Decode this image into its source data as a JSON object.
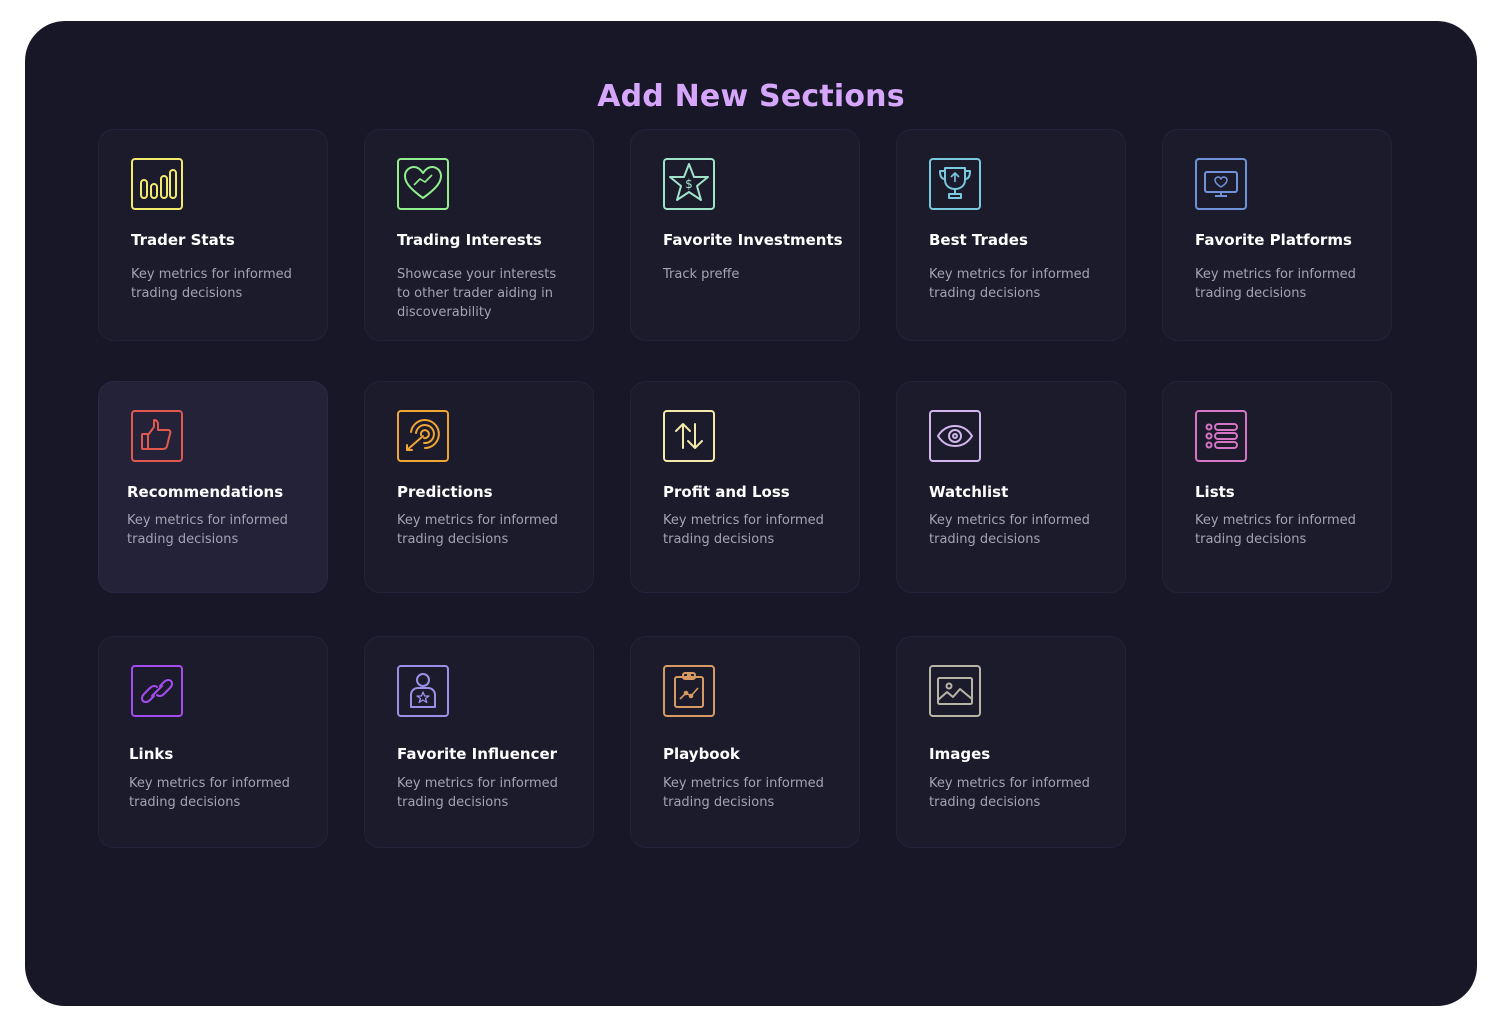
{
  "page": {
    "title": "Add New Sections"
  },
  "sections": [
    {
      "id": "trader-stats",
      "title": "Trader Stats",
      "description": "Key metrics for informed trading decisions",
      "icon": "bar-chart-icon",
      "color": "#f2ea6e"
    },
    {
      "id": "trading-interests",
      "title": "Trading Interests",
      "description": "Showcase your interests to other trader aiding in discoverability",
      "icon": "heart-chart-icon",
      "color": "#8ff08c"
    },
    {
      "id": "favorite-investments",
      "title": "Favorite Investments",
      "description": "Track preffe",
      "icon": "star-dollar-icon",
      "color": "#9fe3c9"
    },
    {
      "id": "best-trades",
      "title": "Best Trades",
      "description": "Key metrics for informed trading decisions",
      "icon": "trophy-icon",
      "color": "#79c9df"
    },
    {
      "id": "favorite-platforms",
      "title": "Favorite Platforms",
      "description": "Key metrics for informed trading decisions",
      "icon": "monitor-heart-icon",
      "color": "#6f93d8"
    },
    {
      "id": "recommendations",
      "title": "Recommendations",
      "description": "Key metrics for informed trading decisions",
      "icon": "thumbs-up-icon",
      "color": "#e0594f"
    },
    {
      "id": "predictions",
      "title": "Predictions",
      "description": "Key metrics for informed trading decisions",
      "icon": "target-icon",
      "color": "#efa534"
    },
    {
      "id": "profit-and-loss",
      "title": "Profit and Loss",
      "description": "Key metrics for informed trading decisions",
      "icon": "up-down-arrows-icon",
      "color": "#f3e9a8"
    },
    {
      "id": "watchlist",
      "title": "Watchlist",
      "description": "Key metrics for informed trading decisions",
      "icon": "eye-icon",
      "color": "#d2b6ee"
    },
    {
      "id": "lists",
      "title": "Lists",
      "description": "Key metrics for informed trading decisions",
      "icon": "list-icon",
      "color": "#d575c4"
    },
    {
      "id": "links",
      "title": "Links",
      "description": "Key metrics for informed trading decisions",
      "icon": "link-icon",
      "color": "#a54cf0"
    },
    {
      "id": "favorite-influencer",
      "title": "Favorite Influencer",
      "description": "Key metrics for informed trading decisions",
      "icon": "influencer-badge-icon",
      "color": "#9b90e8"
    },
    {
      "id": "playbook",
      "title": "Playbook",
      "description": "Key metrics for informed trading decisions",
      "icon": "clipboard-chart-icon",
      "color": "#d69a62"
    },
    {
      "id": "images",
      "title": "Images",
      "description": "Key metrics for informed trading decisions",
      "icon": "image-icon",
      "color": "#b8b4a6"
    }
  ]
}
